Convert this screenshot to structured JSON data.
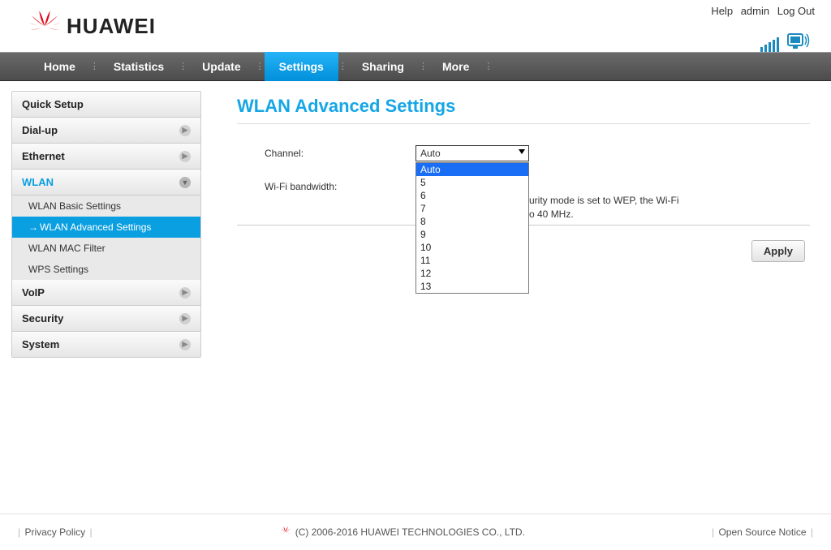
{
  "header": {
    "links": {
      "help": "Help",
      "admin": "admin",
      "logout": "Log Out"
    },
    "brand": "HUAWEI"
  },
  "nav": {
    "items": [
      "Home",
      "Statistics",
      "Update",
      "Settings",
      "Sharing",
      "More"
    ],
    "active": "Settings"
  },
  "sidebar": {
    "quick_setup": "Quick Setup",
    "dialup": "Dial-up",
    "ethernet": "Ethernet",
    "wlan": "WLAN",
    "wlan_sub": {
      "basic": "WLAN Basic Settings",
      "advanced": "WLAN Advanced Settings",
      "mac": "WLAN MAC Filter",
      "wps": "WPS Settings"
    },
    "voip": "VoIP",
    "security": "Security",
    "system": "System"
  },
  "main": {
    "title": "WLAN Advanced Settings",
    "channel_label": "Channel:",
    "channel_value": "Auto",
    "bandwidth_label": "Wi-Fi bandwidth:",
    "help_partial_right": "urity mode is set to WEP, the Wi-Fi",
    "help_partial_right2": "o 40 MHz.",
    "apply": "Apply",
    "dropdown_options": [
      "Auto",
      "5",
      "6",
      "7",
      "8",
      "9",
      "10",
      "11",
      "12",
      "13"
    ],
    "dropdown_selected": "Auto"
  },
  "footer": {
    "privacy": "Privacy Policy",
    "copyright": "(C) 2006-2016 HUAWEI TECHNOLOGIES CO., LTD.",
    "open_source": "Open Source Notice"
  }
}
